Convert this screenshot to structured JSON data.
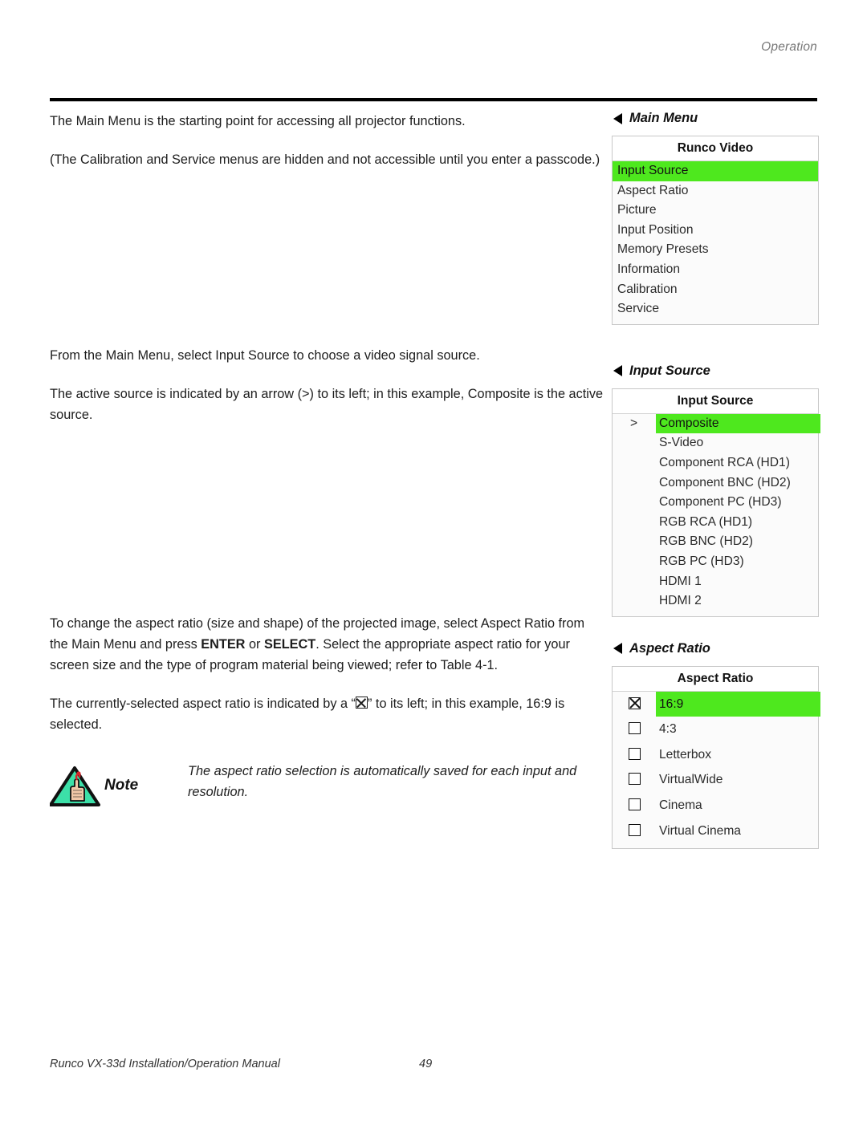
{
  "header": {
    "section": "Operation"
  },
  "footer": {
    "manual": "Runco VX-33d Installation/Operation Manual",
    "page": "49"
  },
  "body": {
    "p1": "The Main Menu is the starting point for accessing all projector functions.",
    "p2": "(The Calibration and Service menus are hidden and not accessible until you enter a passcode.)",
    "p3": "From the Main Menu, select Input Source to choose a video signal source.",
    "p4": "The active source is indicated by an arrow (>) to its left; in this example, Composite is the active source.",
    "p5_a": "To change the aspect ratio (size and shape) of the projected image, select Aspect Ratio from the Main Menu and press ",
    "p5_enter": "ENTER",
    "p5_b": " or ",
    "p5_select": "SELECT",
    "p5_c": ". Select the appropriate aspect ratio for your screen size and the type of program material being viewed; refer to Table 4-1.",
    "p6_a": "The currently-selected aspect ratio is indicated by a “",
    "p6_b": "” to its left; in this example, 16:9 is selected."
  },
  "note": {
    "label": "Note",
    "text": "The aspect ratio selection is automatically saved for each input and resolution."
  },
  "menus": [
    {
      "caption": "Main Menu",
      "title": "Runco Video",
      "style": "plain",
      "items": [
        {
          "label": "Input Source",
          "selected": true
        },
        {
          "label": "Aspect Ratio",
          "selected": false
        },
        {
          "label": "Picture",
          "selected": false
        },
        {
          "label": "Input Position",
          "selected": false
        },
        {
          "label": "Memory Presets",
          "selected": false
        },
        {
          "label": "Information",
          "selected": false
        },
        {
          "label": "Calibration",
          "selected": false
        },
        {
          "label": "Service",
          "selected": false
        }
      ]
    },
    {
      "caption": "Input Source",
      "title": "Input Source",
      "style": "marker",
      "marker": ">",
      "items": [
        {
          "label": "Composite",
          "selected": true,
          "marker": ">"
        },
        {
          "label": "S-Video",
          "selected": false,
          "marker": ""
        },
        {
          "label": "Component RCA (HD1)",
          "selected": false,
          "marker": ""
        },
        {
          "label": "Component BNC (HD2)",
          "selected": false,
          "marker": ""
        },
        {
          "label": "Component PC (HD3)",
          "selected": false,
          "marker": ""
        },
        {
          "label": "RGB RCA (HD1)",
          "selected": false,
          "marker": ""
        },
        {
          "label": "RGB BNC (HD2)",
          "selected": false,
          "marker": ""
        },
        {
          "label": "RGB PC (HD3)",
          "selected": false,
          "marker": ""
        },
        {
          "label": "HDMI 1",
          "selected": false,
          "marker": ""
        },
        {
          "label": "HDMI 2",
          "selected": false,
          "marker": ""
        }
      ]
    },
    {
      "caption": "Aspect Ratio",
      "title": "Aspect Ratio",
      "style": "checkbox",
      "items": [
        {
          "label": "16:9",
          "selected": true,
          "checked": true
        },
        {
          "label": "4:3",
          "selected": false,
          "checked": false
        },
        {
          "label": "Letterbox",
          "selected": false,
          "checked": false
        },
        {
          "label": "VirtualWide",
          "selected": false,
          "checked": false
        },
        {
          "label": "Cinema",
          "selected": false,
          "checked": false
        },
        {
          "label": "Virtual Cinema",
          "selected": false,
          "checked": false
        }
      ]
    }
  ],
  "colors": {
    "highlight": "#4ee81e",
    "note_triangle": "#3ce0a8",
    "rule": "#000000"
  }
}
